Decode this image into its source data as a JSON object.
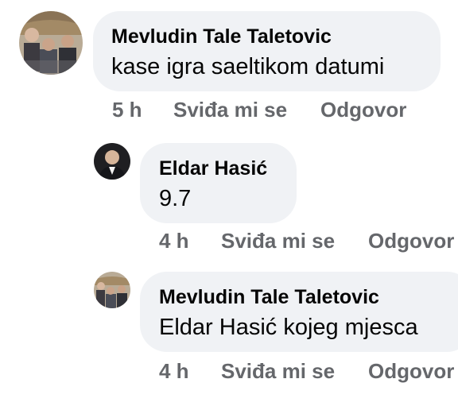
{
  "comments": [
    {
      "author": "Mevludin Tale Taletovic",
      "text": "kase igra saeltikom datumi",
      "time": "5 h",
      "like_label": "Sviđa mi se",
      "reply_label": "Odgovor"
    },
    {
      "author": "Eldar Hasić",
      "text": "9.7",
      "time": "4 h",
      "like_label": "Sviđa mi se",
      "reply_label": "Odgovor"
    },
    {
      "author": "Mevludin Tale Taletovic",
      "text": "Eldar Hasić kojeg mjesca",
      "time": "4 h",
      "like_label": "Sviđa mi se",
      "reply_label": "Odgovor"
    }
  ],
  "colors": {
    "bubble_bg": "#f0f2f5",
    "author_text": "#050505",
    "meta_text": "#65676b"
  }
}
